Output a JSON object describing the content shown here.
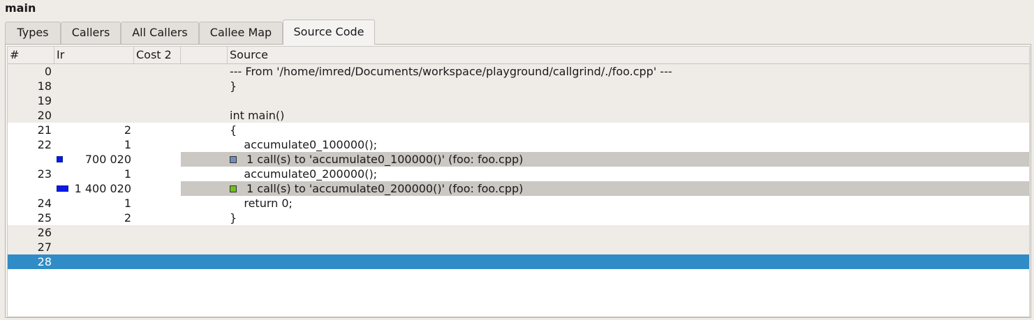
{
  "window_title": "main",
  "tabs": [
    {
      "label": "Types",
      "mnemonic": "T",
      "rest": "ypes"
    },
    {
      "label": "Callers"
    },
    {
      "label": "All Callers",
      "pre": "A",
      "mnemonic": "l",
      "rest": "l Callers"
    },
    {
      "label": "Callee Map"
    },
    {
      "label": "Source Code",
      "pre": "S",
      "mnemonic": "o",
      "rest": "urce Code",
      "active": true
    }
  ],
  "columns": [
    "#",
    "Ir",
    "Cost 2",
    "",
    "Source"
  ],
  "rows": [
    {
      "line": "0",
      "ir": "",
      "cost2": "",
      "source": "--- From '/home/imred/Documents/workspace/playground/callgrind/./foo.cpp' ---"
    },
    {
      "line": "18",
      "ir": "",
      "cost2": "",
      "source": "}"
    },
    {
      "line": "19",
      "ir": "",
      "cost2": "",
      "source": ""
    },
    {
      "line": "20",
      "ir": "",
      "cost2": "",
      "source": "int main()"
    },
    {
      "line": "21",
      "ir": "2",
      "cost2": "",
      "source": "{"
    },
    {
      "line": "22",
      "ir": "1",
      "cost2": "",
      "source": "    accumulate0_100000();"
    },
    {
      "line": "",
      "ir": "700 020",
      "cost2": "",
      "source": "1 call(s) to 'accumulate0_100000()' (foo: foo.cpp)",
      "call": true,
      "swatch_color": "#6f8fc0",
      "ir_fraction": 0.0145
    },
    {
      "line": "23",
      "ir": "1",
      "cost2": "",
      "source": "    accumulate0_200000();"
    },
    {
      "line": "",
      "ir": "1 400 020",
      "cost2": "",
      "source": "1 call(s) to 'accumulate0_200000()' (foo: foo.cpp)",
      "call": true,
      "swatch_color": "#6fbf1f",
      "ir_fraction": 0.029
    },
    {
      "line": "24",
      "ir": "1",
      "cost2": "",
      "source": "    return 0;"
    },
    {
      "line": "25",
      "ir": "2",
      "cost2": "",
      "source": "}"
    },
    {
      "line": "26",
      "ir": "",
      "cost2": "",
      "source": ""
    },
    {
      "line": "27",
      "ir": "",
      "cost2": "",
      "source": ""
    },
    {
      "line": "28",
      "ir": "",
      "cost2": "",
      "source": "",
      "selected": true
    }
  ],
  "colors": {
    "selection": "#308cc6",
    "call_highlight": "#cbc7c3",
    "cost_bar": "#0a18e8"
  }
}
